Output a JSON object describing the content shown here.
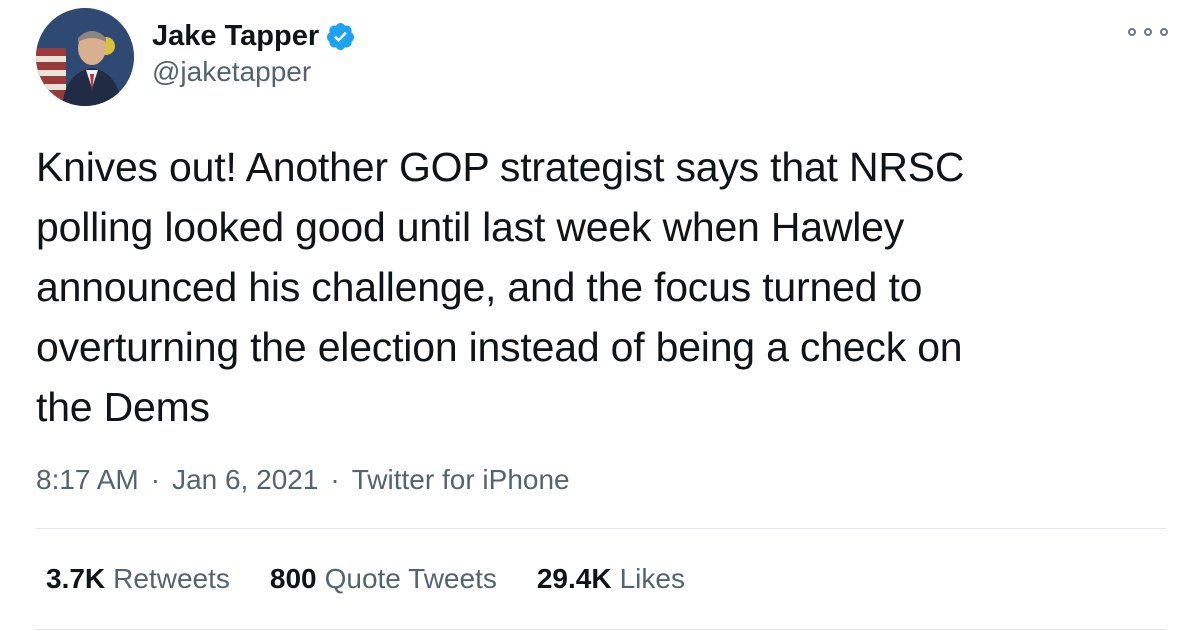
{
  "user": {
    "display_name": "Jake Tapper",
    "handle": "@jaketapper",
    "verified": true,
    "avatar_icon": "profile-photo"
  },
  "tweet": {
    "text": "Knives out! Another GOP strategist says that NRSC\npolling looked good until last week when Hawley\nannounced his challenge, and the focus turned to\noverturning the election instead of being a check on\nthe Dems",
    "time": "8:17 AM",
    "date": "Jan 6, 2021",
    "source": "Twitter for iPhone",
    "separator": "·"
  },
  "stats": {
    "retweets_count": "3.7K",
    "retweets_label": "Retweets",
    "quotes_count": "800",
    "quotes_label": "Quote Tweets",
    "likes_count": "29.4K",
    "likes_label": "Likes"
  },
  "colors": {
    "text_primary": "#0f1419",
    "text_secondary": "#536471",
    "verified_blue": "#1da1f2",
    "divider": "#e1e8ed"
  },
  "icons": {
    "more": "more-options-icon",
    "verified": "verified-badge-icon"
  }
}
